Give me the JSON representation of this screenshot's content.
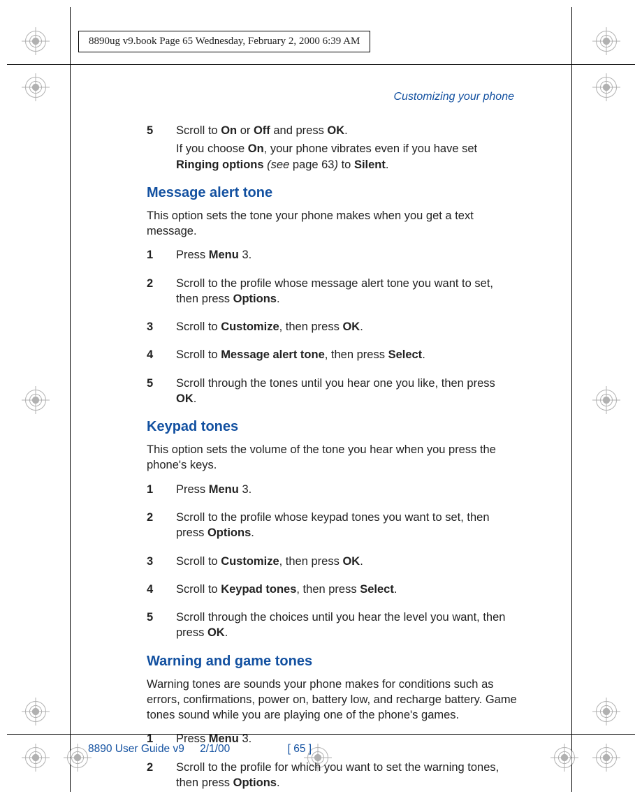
{
  "header": {
    "book_info": "8890ug v9.book  Page 65  Wednesday, February 2, 2000  6:39 AM"
  },
  "running_head": "Customizing your phone",
  "intro_step": {
    "num": "5",
    "line1_a": "Scroll to ",
    "line1_b": "On",
    "line1_c": " or ",
    "line1_d": "Off",
    "line1_e": " and press ",
    "line1_f": "OK",
    "line1_g": ".",
    "line2_a": "If you choose ",
    "line2_b": "On",
    "line2_c": ", your phone vibrates even if you have set ",
    "line2_d": "Ringing options",
    "line2_e": " (see ",
    "line2_f": "page 63",
    "line2_g": ") ",
    "line2_h": "to ",
    "line2_i": "Silent",
    "line2_j": "."
  },
  "sect1": {
    "title": "Message alert tone",
    "intro": "This option sets the tone your phone makes when you get a text message.",
    "steps": [
      {
        "num": "1",
        "a": "Press ",
        "b": "Menu",
        "c": " 3."
      },
      {
        "num": "2",
        "a": "Scroll to the profile whose message alert tone you want to set, then press ",
        "b": "Options",
        "c": "."
      },
      {
        "num": "3",
        "a": "Scroll to ",
        "b": "Customize",
        "c": ", then press ",
        "d": "OK",
        "e": "."
      },
      {
        "num": "4",
        "a": "Scroll to ",
        "b": "Message alert tone",
        "c": ", then press ",
        "d": "Select",
        "e": "."
      },
      {
        "num": "5",
        "a": "Scroll through the tones until you hear one you like, then press ",
        "b": "OK",
        "c": "."
      }
    ]
  },
  "sect2": {
    "title": "Keypad tones",
    "intro": "This option sets the volume of the tone you hear when you press the phone's keys.",
    "steps": [
      {
        "num": "1",
        "a": "Press ",
        "b": "Menu",
        "c": " 3."
      },
      {
        "num": "2",
        "a": "Scroll to the profile whose keypad tones you want to set, then press ",
        "b": "Options",
        "c": "."
      },
      {
        "num": "3",
        "a": "Scroll to ",
        "b": "Customize",
        "c": ", then press ",
        "d": "OK",
        "e": "."
      },
      {
        "num": "4",
        "a": "Scroll to ",
        "b": "Keypad tones",
        "c": ", then press ",
        "d": "Select",
        "e": "."
      },
      {
        "num": "5",
        "a": "Scroll through the choices until you hear the level you want, then press ",
        "b": "OK",
        "c": "."
      }
    ]
  },
  "sect3": {
    "title": "Warning and game tones",
    "intro": "Warning tones are sounds your phone makes for conditions such as errors, confirmations, power on, battery low, and recharge battery. Game tones sound while you are playing one of the phone's games.",
    "steps": [
      {
        "num": "1",
        "a": "Press ",
        "b": "Menu",
        "c": " 3."
      },
      {
        "num": "2",
        "a": "Scroll to the profile for which you want to set the warning tones, then press ",
        "b": "Options",
        "c": "."
      }
    ]
  },
  "footer": {
    "doc": "8890 User Guide v9",
    "date": "2/1/00",
    "page": "[ 65 ]"
  }
}
